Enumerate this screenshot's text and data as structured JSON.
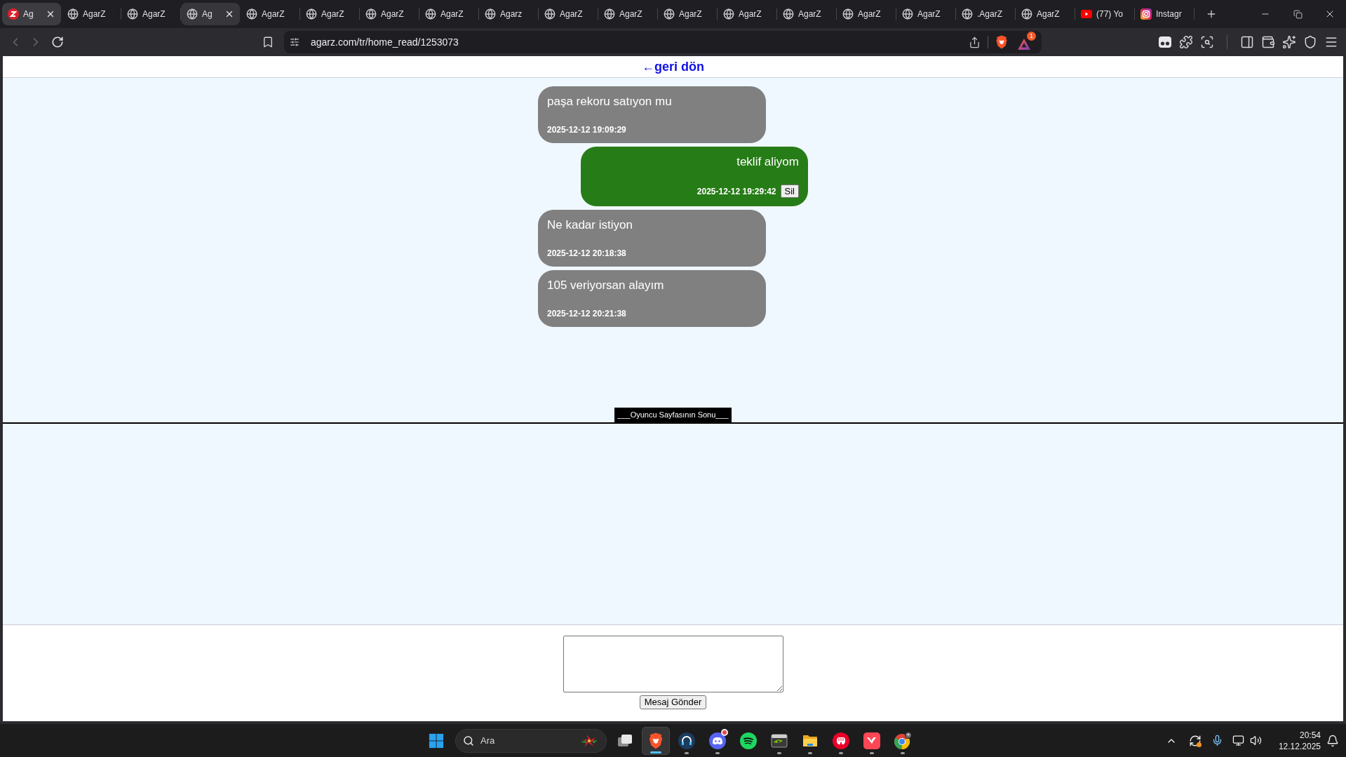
{
  "browser": {
    "tabs": [
      {
        "label": "Ag",
        "kind": "agarz",
        "selected": true,
        "hovered": false
      },
      {
        "label": "AgarZ",
        "kind": "globe",
        "selected": false,
        "hovered": false
      },
      {
        "label": "AgarZ",
        "kind": "globe",
        "selected": false,
        "hovered": false
      },
      {
        "label": "Ag",
        "kind": "globe",
        "selected": false,
        "hovered": true
      },
      {
        "label": "AgarZ",
        "kind": "globe",
        "selected": false,
        "hovered": false
      },
      {
        "label": "AgarZ",
        "kind": "globe",
        "selected": false,
        "hovered": false
      },
      {
        "label": "AgarZ",
        "kind": "globe",
        "selected": false,
        "hovered": false
      },
      {
        "label": "AgarZ",
        "kind": "globe",
        "selected": false,
        "hovered": false
      },
      {
        "label": "Agarz",
        "kind": "globe",
        "selected": false,
        "hovered": false
      },
      {
        "label": "AgarZ",
        "kind": "globe",
        "selected": false,
        "hovered": false
      },
      {
        "label": "AgarZ",
        "kind": "globe",
        "selected": false,
        "hovered": false
      },
      {
        "label": "AgarZ",
        "kind": "globe",
        "selected": false,
        "hovered": false
      },
      {
        "label": "AgarZ",
        "kind": "globe",
        "selected": false,
        "hovered": false
      },
      {
        "label": "AgarZ",
        "kind": "globe",
        "selected": false,
        "hovered": false
      },
      {
        "label": "AgarZ",
        "kind": "globe",
        "selected": false,
        "hovered": false
      },
      {
        "label": "AgarZ",
        "kind": "globe",
        "selected": false,
        "hovered": false
      },
      {
        "label": ".AgarZ",
        "kind": "globe",
        "selected": false,
        "hovered": false
      },
      {
        "label": "AgarZ",
        "kind": "globe",
        "selected": false,
        "hovered": false
      },
      {
        "label": "(77) Yo",
        "kind": "youtube",
        "selected": false,
        "hovered": false
      },
      {
        "label": "Instagr",
        "kind": "instagram",
        "selected": false,
        "hovered": false
      }
    ],
    "navigation": {
      "back_disabled": true,
      "forward_disabled": true
    },
    "address_bar": {
      "url": "agarz.com/tr/home_read/1253073"
    },
    "rewards_badge": "1"
  },
  "page": {
    "back_link": "←geri dön",
    "messages": [
      {
        "kind": "received",
        "text": "paşa rekoru satıyon mu",
        "time": "2025-12-12 19:09:29"
      },
      {
        "kind": "sent",
        "text": "teklif aliyom",
        "time": "2025-12-12 19:29:42",
        "delete_label": "Sil"
      },
      {
        "kind": "received",
        "text": "Ne kadar istiyon",
        "time": "2025-12-12 20:18:38"
      },
      {
        "kind": "received",
        "text": "105 veriyorsan alayım",
        "time": "2025-12-12 20:21:38"
      }
    ],
    "end_marker": "___Oyuncu Sayfasının Sonu___",
    "compose": {
      "send_label": "Mesaj Gönder"
    }
  },
  "taskbar": {
    "search": {
      "placeholder": "Ara"
    },
    "apps": [
      {
        "kind": "task-view",
        "running": false,
        "active": false,
        "notified": false
      },
      {
        "kind": "brave",
        "running": true,
        "active": true,
        "notified": false
      },
      {
        "kind": "headset",
        "running": true,
        "active": false,
        "notified": false
      },
      {
        "kind": "discord",
        "running": true,
        "active": false,
        "notified": true
      },
      {
        "kind": "spotify",
        "running": false,
        "active": false,
        "notified": false
      },
      {
        "kind": "nvidia",
        "running": true,
        "active": false,
        "notified": false
      },
      {
        "kind": "folder",
        "running": true,
        "active": false,
        "notified": false
      },
      {
        "kind": "riot",
        "running": true,
        "active": false,
        "notified": false
      },
      {
        "kind": "valorant",
        "running": true,
        "active": false,
        "notified": false
      },
      {
        "kind": "chrome",
        "running": true,
        "active": false,
        "notified": false
      }
    ],
    "clock": {
      "time": "20:54",
      "date": "12.12.2025"
    }
  }
}
